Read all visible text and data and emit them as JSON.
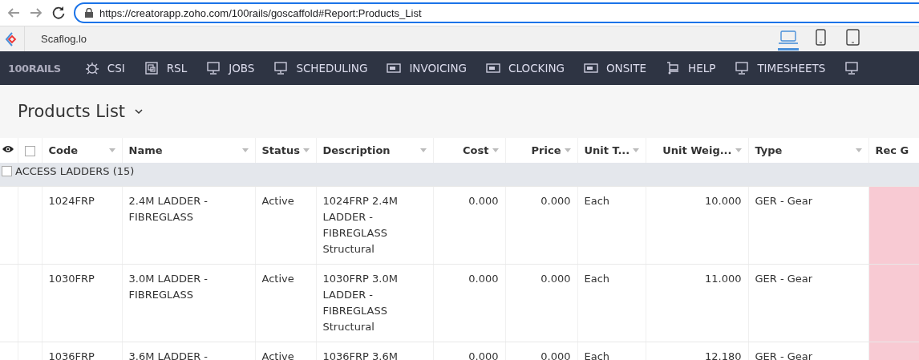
{
  "browser": {
    "url": "https://creatorapp.zoho.com/100rails/goscaffold#Report:Products_List"
  },
  "app_bar": {
    "title": "Scaflog.lo",
    "devices": [
      {
        "kind": "laptop",
        "selected": true
      },
      {
        "kind": "phone",
        "selected": false
      },
      {
        "kind": "tablet",
        "selected": false
      }
    ]
  },
  "nav": {
    "logo": "100RAILS",
    "items": [
      {
        "label": "CSI"
      },
      {
        "label": "RSL"
      },
      {
        "label": "JOBS"
      },
      {
        "label": "SCHEDULING"
      },
      {
        "label": "INVOICING"
      },
      {
        "label": "CLOCKING"
      },
      {
        "label": "ONSITE"
      },
      {
        "label": "HELP"
      },
      {
        "label": "TIMESHEETS"
      }
    ]
  },
  "report": {
    "title": "Products List"
  },
  "table": {
    "select_all": {
      "checked": false
    },
    "columns": [
      {
        "label": "Code"
      },
      {
        "label": "Name"
      },
      {
        "label": "Status"
      },
      {
        "label": "Description"
      },
      {
        "label": "Cost"
      },
      {
        "label": "Price"
      },
      {
        "label": "Unit T..."
      },
      {
        "label": "Unit Weig..."
      },
      {
        "label": "Type"
      },
      {
        "label": "Rec G"
      }
    ],
    "groups": [
      {
        "label": "ACCESS LADDERS (15)",
        "checked": false,
        "rows": [
          {
            "cells": [
              "1024FRP",
              "2.4M LADDER - FIBREGLASS",
              "Active",
              "1024FRP 2.4M LADDER - FIBREGLASS Structural",
              "0.000",
              "0.000",
              "Each",
              "10.000",
              "GER - Gear"
            ]
          },
          {
            "cells": [
              "1030FRP",
              "3.0M LADDER - FIBREGLASS",
              "Active",
              "1030FRP 3.0M LADDER - FIBREGLASS Structural",
              "0.000",
              "0.000",
              "Each",
              "11.000",
              "GER - Gear"
            ]
          },
          {
            "cells": [
              "1036FRP",
              "3.6M LADDER -",
              "Active",
              "1036FRP 3.6M",
              "0.000",
              "0.000",
              "Each",
              "12.180",
              "GER - Gear"
            ]
          }
        ]
      }
    ]
  }
}
